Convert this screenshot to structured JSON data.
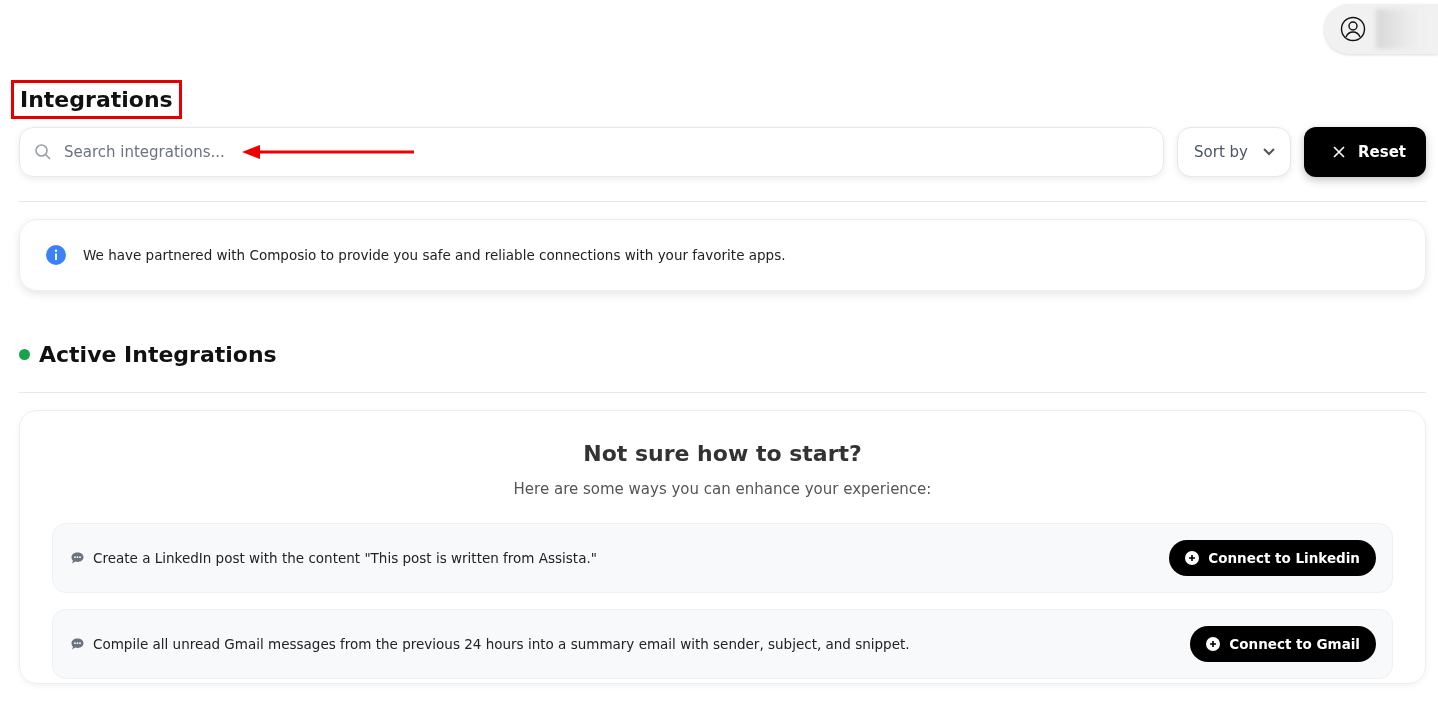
{
  "user_menu": {
    "name_blurred": true
  },
  "page_title": {
    "text": "Integrations",
    "highlighted": true
  },
  "search": {
    "placeholder": "Search integrations...",
    "arrow_pointer": true
  },
  "sort": {
    "label": "Sort by"
  },
  "reset_button": {
    "label": "Reset"
  },
  "info_banner": {
    "text": "We have partnered with Composio to provide you safe and reliable connections with your favorite apps."
  },
  "active_section": {
    "title": "Active Integrations",
    "color": "#16a34a"
  },
  "empty_state": {
    "title": "Not sure how to start?",
    "subtitle": "Here are some ways you can enhance your experience:",
    "suggestions": [
      {
        "text": "Create a LinkedIn post with the content \"This post is written from Assista.\"",
        "button": "Connect to Linkedin"
      },
      {
        "text": "Compile all unread Gmail messages from the previous 24 hours into a summary email with sender, subject, and snippet.",
        "button": "Connect to Gmail"
      }
    ]
  }
}
